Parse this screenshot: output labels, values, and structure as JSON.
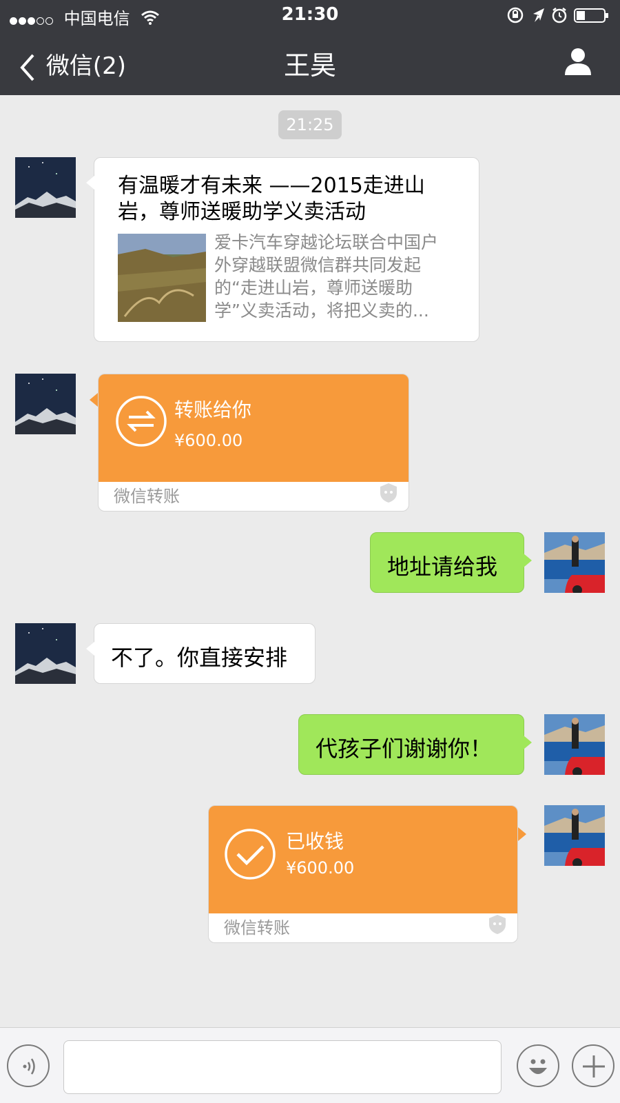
{
  "status_bar": {
    "carrier": "中国电信",
    "time": "21:30",
    "signal_level": 3,
    "signal_max": 5
  },
  "nav": {
    "back_label": "微信(2)",
    "title": "王昊"
  },
  "chat": {
    "timestamp": "21:25",
    "messages": [
      {
        "type": "link_card",
        "side": "left",
        "title": "有温暖才有未来 ——2015走进山岩，尊师送暖助学义卖活动",
        "title_line1": "有温暖才有未来 ——2015走进山",
        "title_line2": "岩，尊师送暖助学义卖活动",
        "desc_line1": "爱卡汽车穿越论坛联合中国户",
        "desc_line2": "外穿越联盟微信群共同发起",
        "desc_line3": "的“走进山岩，尊师送暖助",
        "desc_line4": "学”义卖活动，将把义卖的..."
      },
      {
        "type": "transfer",
        "side": "left",
        "title": "转账给你",
        "amount": "¥600.00",
        "footer": "微信转账"
      },
      {
        "type": "text",
        "side": "right",
        "text": "地址请给我"
      },
      {
        "type": "text",
        "side": "left",
        "text": "不了。你直接安排"
      },
      {
        "type": "text",
        "side": "right",
        "text": "代孩子们谢谢你！"
      },
      {
        "type": "transfer",
        "side": "right",
        "title": "已收钱",
        "amount": "¥600.00",
        "footer": "微信转账"
      }
    ]
  },
  "colors": {
    "topbar": "#393a3f",
    "chat_bg": "#ebebeb",
    "bubble_green": "#a0e75a",
    "transfer_orange": "#f79a3b"
  },
  "icons": {
    "back": "chevron-left-icon",
    "profile": "person-icon",
    "voice": "voice-icon",
    "emoji": "emoji-icon",
    "more": "plus-icon",
    "transfer": "transfer-arrows-icon",
    "received": "checkmark-icon"
  }
}
